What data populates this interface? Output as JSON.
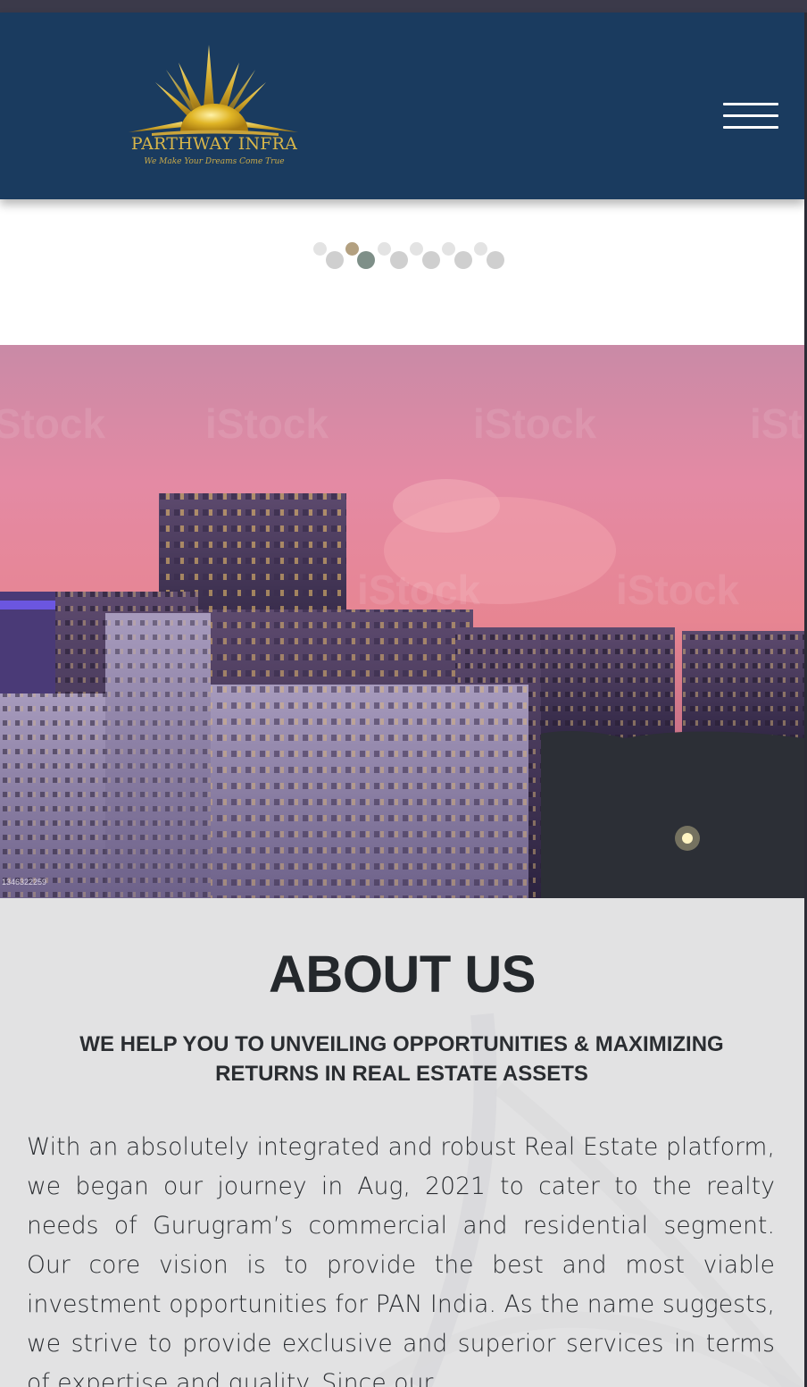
{
  "header": {
    "logo_name": "PARTHWAY INFRA",
    "logo_tagline": "We Make Your Dreams Come True",
    "menu_icon": "hamburger-menu-icon",
    "background_color": "#1a3b5f",
    "accent_gold": "#d8b64a"
  },
  "slider": {
    "dot_count": 12,
    "active_index": 2
  },
  "hero": {
    "image_id_text": "1346322259",
    "watermark_text": "iStock"
  },
  "about": {
    "title": "ABOUT US",
    "subtitle": "WE HELP YOU TO UNVEILING OPPORTUNITIES & MAXIMIZING RETURNS IN REAL ESTATE ASSETS",
    "body": "With an absolutely integrated and robust Real Estate platform, we began our journey in Aug, 2021 to cater to the realty needs of Gurugram’s commercial and residential segment. Our core vision is to provide the best and most viable investment opportunities for PAN India. As the name suggests, we strive to provide exclusive and superior services in terms of expertise and quality. Since our"
  }
}
